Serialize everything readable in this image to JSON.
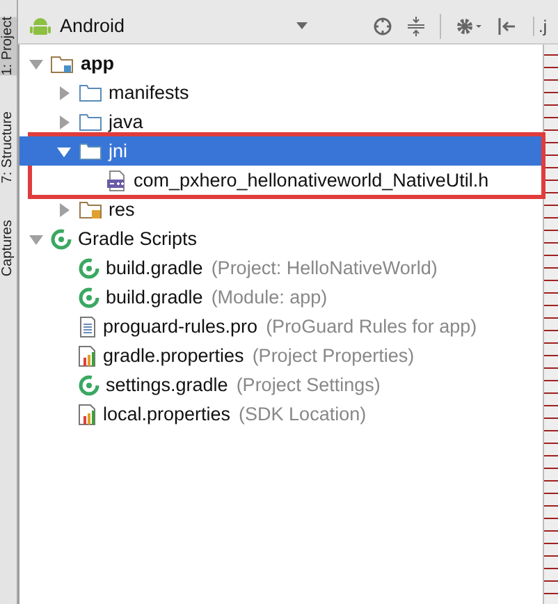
{
  "side_tabs": [
    {
      "label": "1: Project",
      "selected": true
    },
    {
      "label": "7: Structure",
      "selected": false
    },
    {
      "label": "Captures",
      "selected": false
    }
  ],
  "panel": {
    "view": "Android",
    "next_tab": ".j"
  },
  "tree": [
    {
      "label": "app",
      "kind": "module",
      "expanded": true,
      "selected": false,
      "children": [
        {
          "label": "manifests",
          "kind": "folder",
          "expanded": false,
          "selected": false
        },
        {
          "label": "java",
          "kind": "folder",
          "expanded": false,
          "selected": false
        },
        {
          "label": "jni",
          "kind": "folder",
          "expanded": true,
          "selected": true,
          "highlighted": true,
          "children": [
            {
              "label": "com_pxhero_hellonativeworld_NativeUtil.h",
              "kind": "cpp",
              "selected": false,
              "highlighted": true
            }
          ]
        },
        {
          "label": "res",
          "kind": "res",
          "expanded": false,
          "selected": false
        }
      ]
    },
    {
      "label": "Gradle Scripts",
      "kind": "gradle",
      "expanded": true,
      "selected": false,
      "children": [
        {
          "label": "build.gradle",
          "note": "(Project: HelloNativeWorld)",
          "kind": "gradle",
          "selected": false
        },
        {
          "label": "build.gradle",
          "note": "(Module: app)",
          "kind": "gradle",
          "selected": false
        },
        {
          "label": "proguard-rules.pro",
          "note": "(ProGuard Rules for app)",
          "kind": "text",
          "selected": false
        },
        {
          "label": "gradle.properties",
          "note": "(Project Properties)",
          "kind": "properties",
          "selected": false
        },
        {
          "label": "settings.gradle",
          "note": "(Project Settings)",
          "kind": "gradle",
          "selected": false
        },
        {
          "label": "local.properties",
          "note": "(SDK Location)",
          "kind": "properties",
          "selected": false
        }
      ]
    }
  ]
}
